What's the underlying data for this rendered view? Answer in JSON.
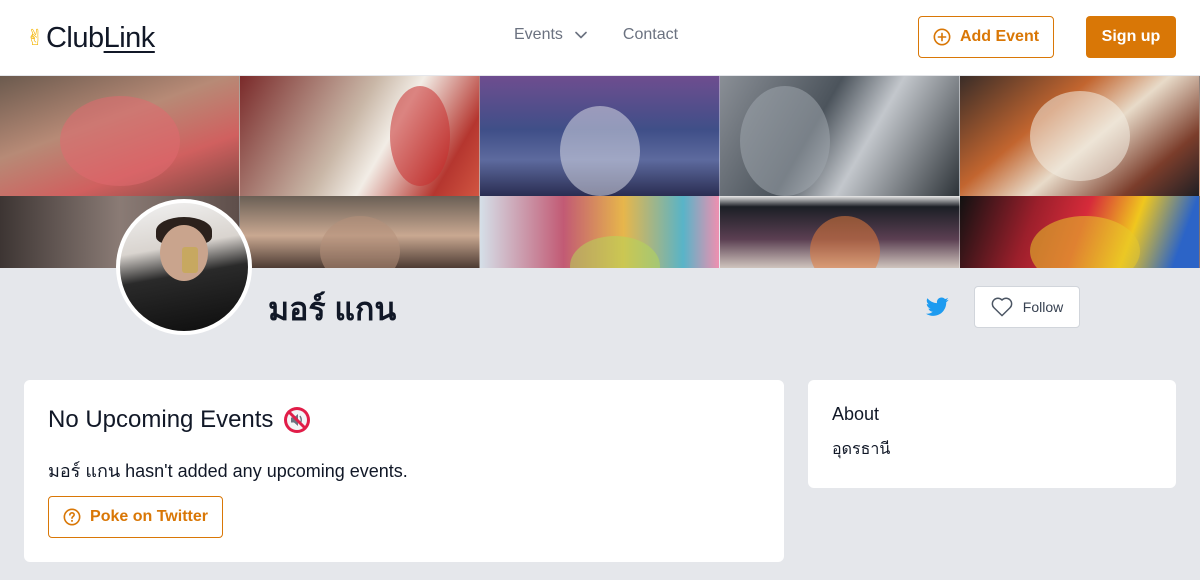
{
  "header": {
    "logo": {
      "icon": "victory-hand-icon",
      "club": "Club",
      "link": "Link"
    },
    "nav": {
      "events_label": "Events",
      "contact_label": "Contact"
    },
    "add_event_label": "Add Event",
    "sign_up_label": "Sign up"
  },
  "profile": {
    "name": "มอร์ แกน",
    "follow_label": "Follow",
    "social_icon": "twitter-icon"
  },
  "events_card": {
    "title": "No Upcoming Events",
    "title_icon": "muted-speaker-icon",
    "message": "มอร์ แกน hasn't added any upcoming events.",
    "poke_label": "Poke on Twitter"
  },
  "about_card": {
    "label": "About",
    "value": "อุดรธานี"
  },
  "colors": {
    "accent": "#d97706",
    "background": "#e5e7eb",
    "twitter": "#1d9bf0"
  }
}
